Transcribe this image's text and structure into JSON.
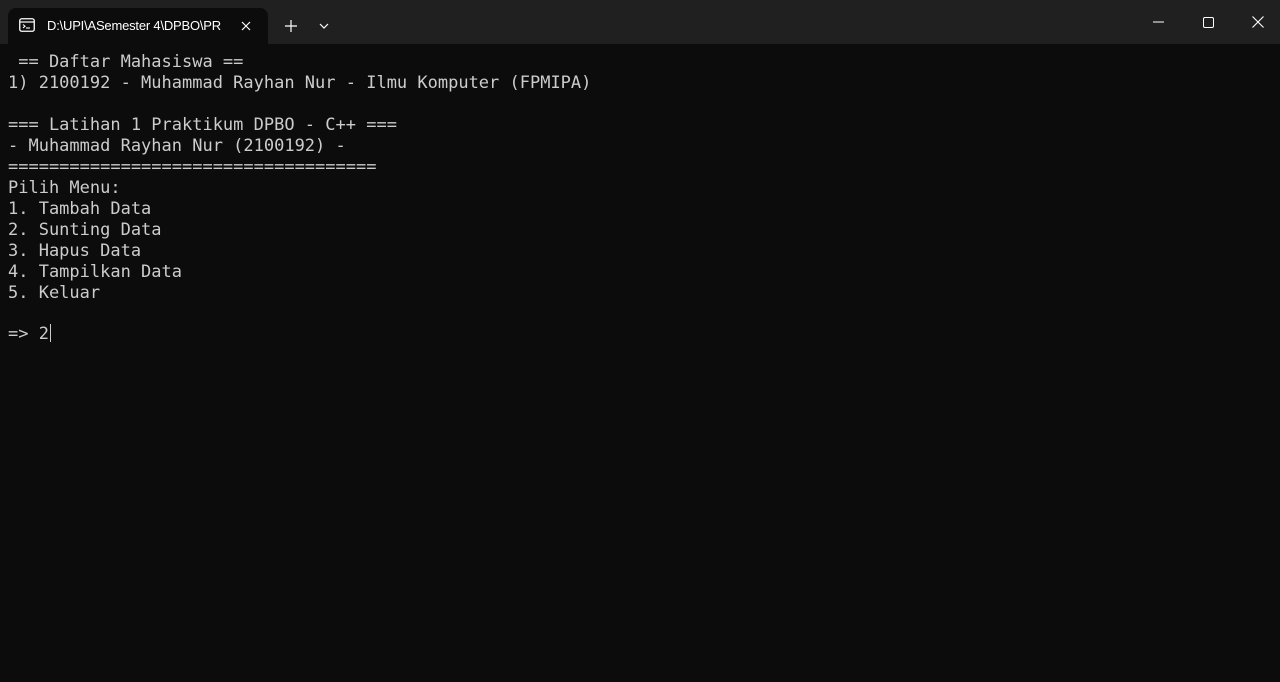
{
  "tab": {
    "title": "D:\\UPI\\ASemester 4\\DPBO\\PR",
    "icon": "terminal-icon"
  },
  "titlebar_icons": {
    "close_tab": "close-icon",
    "new_tab": "plus-icon",
    "dropdown": "chevron-down-icon",
    "minimize": "minimize-icon",
    "maximize": "maximize-icon",
    "close_window": "close-icon"
  },
  "terminal": {
    "lines": [
      " == Daftar Mahasiswa ==",
      "1) 2100192 - Muhammad Rayhan Nur - Ilmu Komputer (FPMIPA)",
      "",
      "=== Latihan 1 Praktikum DPBO - C++ ===",
      "- Muhammad Rayhan Nur (2100192) -",
      "====================================",
      "Pilih Menu:",
      "1. Tambah Data",
      "2. Sunting Data",
      "3. Hapus Data",
      "4. Tampilkan Data",
      "5. Keluar",
      "",
      "=> 2"
    ]
  },
  "colors": {
    "background": "#0c0c0c",
    "titlebar": "#202020",
    "text": "#cccccc"
  }
}
